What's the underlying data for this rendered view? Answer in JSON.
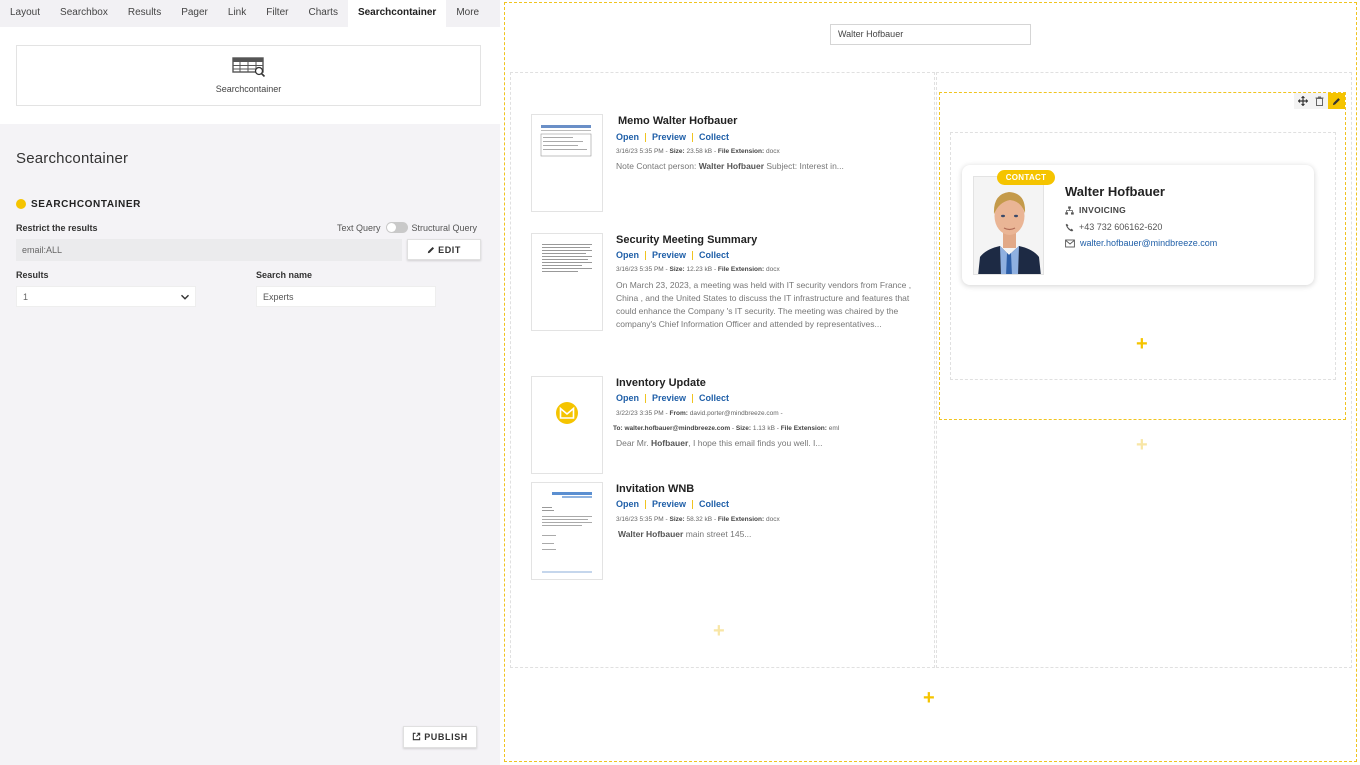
{
  "tabs": [
    {
      "label": "Layout"
    },
    {
      "label": "Searchbox"
    },
    {
      "label": "Results"
    },
    {
      "label": "Pager"
    },
    {
      "label": "Link"
    },
    {
      "label": "Filter"
    },
    {
      "label": "Charts"
    },
    {
      "label": "Searchcontainer",
      "active": true
    },
    {
      "label": "More"
    }
  ],
  "widget": {
    "label": "Searchcontainer",
    "icon": "table-search-icon"
  },
  "panel": {
    "title": "Searchcontainer",
    "section_heading": "SEARCHCONTAINER",
    "restrict_label": "Restrict the results",
    "toggle_left": "Text Query",
    "toggle_right": "Structural Query",
    "query_value": "email:ALL",
    "edit_label": "EDIT",
    "results_label": "Results",
    "results_value": "1",
    "search_name_label": "Search name",
    "search_name_value": "Experts",
    "publish_label": "PUBLISH"
  },
  "canvas": {
    "search_value": "Walter Hofbauer",
    "results": [
      {
        "title": "Memo Walter Hofbauer",
        "actions": [
          "Open",
          "Preview",
          "Collect"
        ],
        "meta_date": "3/16/23 5:35 PM",
        "meta_size_label": "Size:",
        "meta_size": "23.58 kB",
        "meta_ext_label": "File Extension:",
        "meta_ext": "docx",
        "snippet_pre": "Note Contact person:  ",
        "snippet_bold": "Walter Hofbauer",
        "snippet_post": "  Subject: Interest in..."
      },
      {
        "title": "Security Meeting Summary",
        "actions": [
          "Open",
          "Preview",
          "Collect"
        ],
        "meta_date": "3/16/23 5:35 PM",
        "meta_size_label": "Size:",
        "meta_size": "12.23 kB",
        "meta_ext_label": "File Extension:",
        "meta_ext": "docx",
        "snippet": "On March 23, 2023, a meeting was held with IT security vendors from  France ,  China , and the  United States  to discuss the IT infrastructure and features that could enhance the  Company 's IT security. The meeting was chaired by the company's Chief Information Officer and attended by representatives..."
      },
      {
        "title": "Inventory Update",
        "actions": [
          "Open",
          "Preview",
          "Collect"
        ],
        "meta_date": "3/22/23 3:35 PM",
        "meta_from_label": "From:",
        "meta_from": "david.porter@mindbreeze.com -",
        "meta_to_label": "To:",
        "meta_to": "walter.hofbauer@mindbreeze.com",
        "meta_size_label": "Size:",
        "meta_size": "1.13 kB",
        "meta_ext_label": "File Extension:",
        "meta_ext": "eml",
        "snippet_pre": "Dear Mr. ",
        "snippet_bold": "Hofbauer",
        "snippet_post": ", I hope this email finds you well. I..."
      },
      {
        "title": "Invitation WNB",
        "actions": [
          "Open",
          "Preview",
          "Collect"
        ],
        "meta_date": "3/16/23 5:35 PM",
        "meta_size_label": "Size:",
        "meta_size": "58.32 kB",
        "meta_ext_label": "File Extension:",
        "meta_ext": "docx",
        "snippet_bold": "Walter Hofbauer",
        "snippet_post": "  main street 145..."
      }
    ],
    "contact": {
      "badge": "CONTACT",
      "name": "Walter Hofbauer",
      "department": "INVOICING",
      "phone": "+43 732 606162-620",
      "email": "walter.hofbauer@mindbreeze.com"
    },
    "plus_glyph": "+",
    "accent_color": "#f5c400",
    "link_color": "#1f5fa8"
  }
}
